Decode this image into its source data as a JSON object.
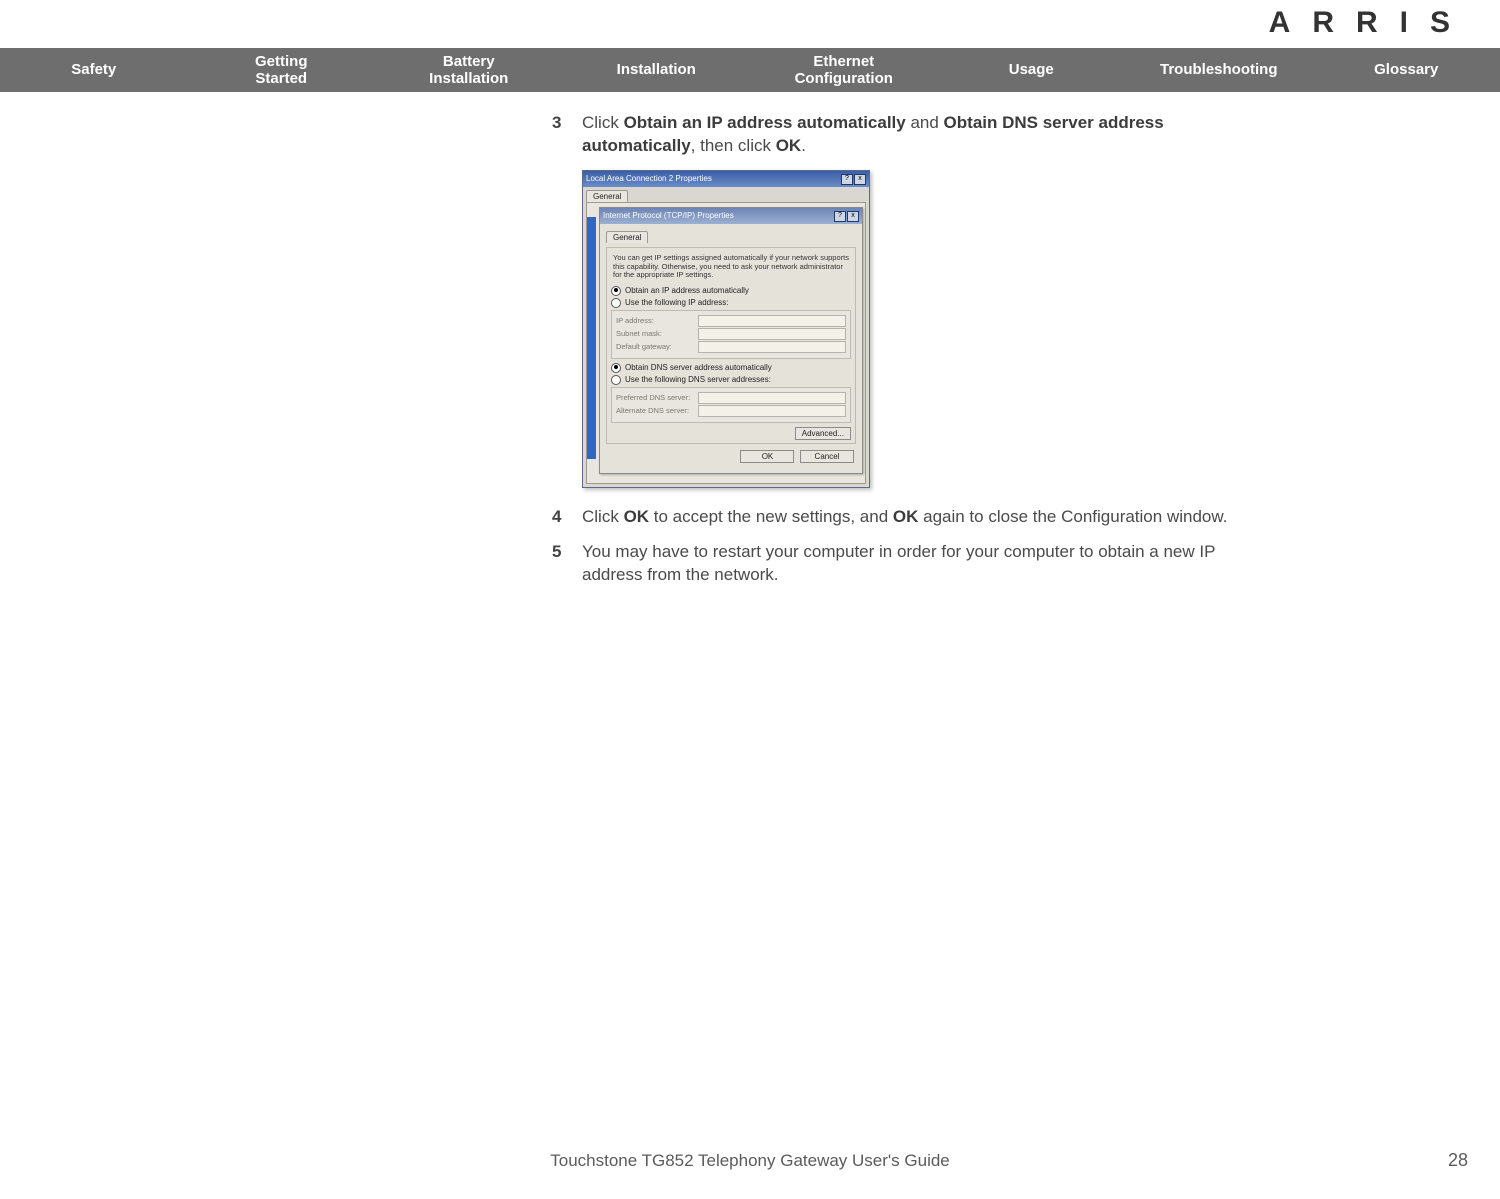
{
  "brand": "ARRIS",
  "nav": {
    "items": [
      "Safety",
      "Getting\nStarted",
      "Battery\nInstallation",
      "Installation",
      "Ethernet\nConfiguration",
      "Usage",
      "Troubleshooting",
      "Glossary"
    ]
  },
  "steps": {
    "s3": {
      "num": "3",
      "pre": "Click ",
      "b1": "Obtain an IP address automatically",
      "mid1": " and ",
      "b2": "Obtain DNS server ad­dress automatically",
      "mid2": ", then click ",
      "b3": "OK",
      "post": "."
    },
    "s4": {
      "num": "4",
      "pre": "Click ",
      "b1": "OK",
      "mid1": " to accept the new settings, and ",
      "b2": "OK",
      "mid2": " again to close the Configura­tion window.",
      "b3": "",
      "post": ""
    },
    "s5": {
      "num": "5",
      "text": "You may have to restart your computer in order for your computer to obtain a new IP address from the network."
    }
  },
  "dialog": {
    "outer_title": "Local Area Connection 2 Properties",
    "outer_tab": "General",
    "inner_title": "Internet Protocol (TCP/IP) Properties",
    "inner_tab": "General",
    "desc": "You can get IP settings assigned automatically if your network supports this capability. Otherwise, you need to ask your network administrator for the appropriate IP settings.",
    "radios": {
      "obtain_ip": "Obtain an IP address automatically",
      "use_ip": "Use the following IP address:",
      "obtain_dns": "Obtain DNS server address automatically",
      "use_dns": "Use the following DNS server addresses:"
    },
    "fields": {
      "ip": "IP address:",
      "subnet": "Subnet mask:",
      "gateway": "Default gateway:",
      "pdns": "Preferred DNS server:",
      "adns": "Alternate DNS server:"
    },
    "buttons": {
      "advanced": "Advanced...",
      "ok": "OK",
      "cancel": "Cancel"
    }
  },
  "footer": {
    "title": "Touchstone TG852 Telephony Gateway User's Guide",
    "page": "28"
  }
}
